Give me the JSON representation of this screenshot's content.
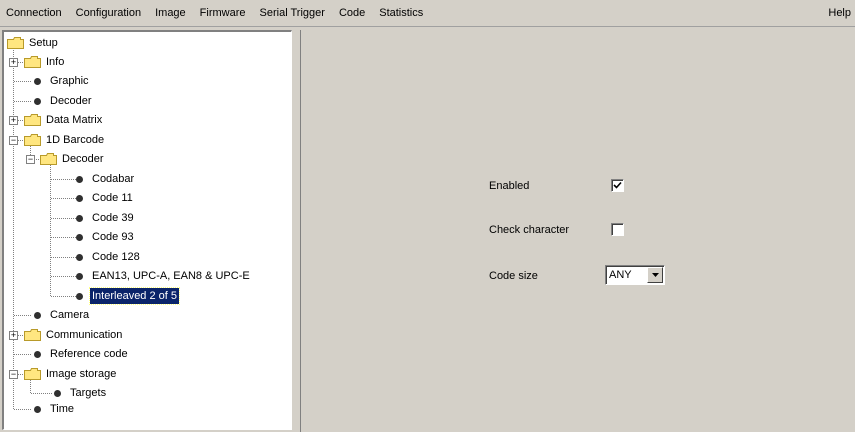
{
  "menu": {
    "items": [
      "Connection",
      "Configuration",
      "Image",
      "Firmware",
      "Serial Trigger",
      "Code",
      "Statistics"
    ],
    "help": "Help"
  },
  "tree": {
    "root": "Setup",
    "info": "Info",
    "graphic": "Graphic",
    "decoder": "Decoder",
    "data_matrix": "Data Matrix",
    "barcode_1d": "1D Barcode",
    "barcode_decoder": "Decoder",
    "codabar": "Codabar",
    "code11": "Code 11",
    "code39": "Code 39",
    "code93": "Code 93",
    "code128": "Code 128",
    "ean": "EAN13, UPC-A, EAN8 & UPC-E",
    "interleaved": "Interleaved 2 of 5",
    "camera": "Camera",
    "communication": "Communication",
    "reference_code": "Reference code",
    "image_storage": "Image storage",
    "targets": "Targets",
    "time": "Time",
    "selected": "Interleaved 2 of 5"
  },
  "form": {
    "enabled_label": "Enabled",
    "enabled_checked": true,
    "check_character_label": "Check character",
    "check_character_checked": false,
    "code_size_label": "Code size",
    "code_size_value": "ANY"
  },
  "icons": {
    "folder": "folder-icon",
    "leaf": "bullet-icon",
    "expand": "plus-box-icon",
    "collapse": "minus-box-icon",
    "check": "checkmark-icon",
    "dropdown": "chevron-down-icon"
  },
  "colors": {
    "window_bg": "#d4d0c8",
    "selection_bg": "#0a246a",
    "folder_fill": "#ffe680",
    "folder_stroke": "#b89a2a"
  }
}
